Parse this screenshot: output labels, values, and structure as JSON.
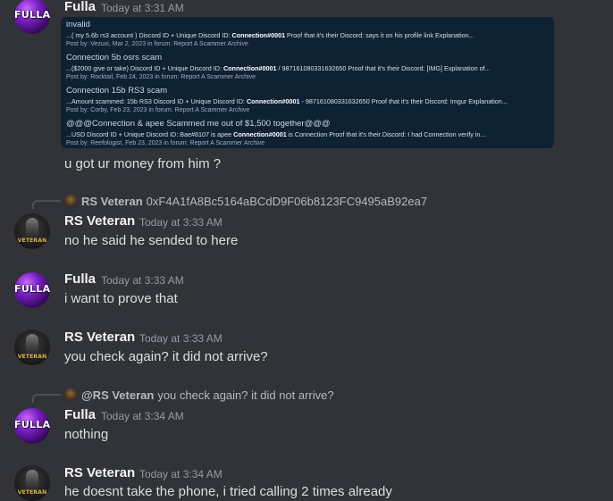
{
  "embed": {
    "results": [
      {
        "title": "invalid",
        "snippet_pre": "...( my 5.6b rs3 account ) Discord ID + Unique Discord ID: ",
        "snippet_bold": "Connection#0001",
        "snippet_post": " Proof that it's their Discord: says it on his profile link Explanation...",
        "posted": "Post by: Vezuxi, Mar 2, 2023 in forum: Report A Scammer Archive"
      },
      {
        "title": "Connection 5b osrs scam",
        "snippet_pre": "...($2000 give or take) Discord ID + Unique Discord ID: ",
        "snippet_bold": "Connection#0001",
        "snippet_post": " / 987161080331632650 Proof that it's their Discord: [IMG] Explanation of...",
        "posted": "Post by: Rocktail, Feb 24, 2023 in forum: Report A Scammer Archive"
      },
      {
        "title": "Connection 15b RS3 scam",
        "snippet_pre": "...Amount scammed: 15b RS3 Discord ID + Unique Discord ID: ",
        "snippet_bold": "Connection#0001",
        "snippet_post": " - 987161080331632650 Proof that it's their Discord: Imgur Explanation...",
        "posted": "Post by: Corby, Feb 23, 2023 in forum: Report A Scammer Archive"
      },
      {
        "title": "@@@Connection & apee Scammed me out of $1,500 together@@@",
        "snippet_pre": "...USD Discord ID + Unique Discord ID: Bae#8107 is apee ",
        "snippet_bold": "Connection#0001",
        "snippet_post": " is Connection Proof that it's their Discord: I had Connection verify in...",
        "posted": "Post by: Reefologist, Feb 23, 2023 in forum: Report A Scammer Archive"
      }
    ]
  },
  "messages": [
    {
      "author": "Fulla",
      "avatar_text": "FULLA",
      "timestamp": "Today at 3:31 AM",
      "text": "u got ur money from him ?"
    },
    {
      "author": "RS Veteran",
      "avatar_text": "VETERAN",
      "timestamp": "Today at 3:33 AM",
      "text": "no he said he sended to here",
      "reply": {
        "author": "RS Veteran",
        "text": "0xF4A1fA8Bc5164aBCdD9F06b8123FC9495aB92ea7"
      }
    },
    {
      "author": "Fulla",
      "avatar_text": "FULLA",
      "timestamp": "Today at 3:33 AM",
      "text": "i want to prove that"
    },
    {
      "author": "RS Veteran",
      "avatar_text": "VETERAN",
      "timestamp": "Today at 3:33 AM",
      "text": "you check again? it did not arrive?"
    },
    {
      "author": "Fulla",
      "avatar_text": "FULLA",
      "timestamp": "Today at 3:34 AM",
      "text": "nothing",
      "reply": {
        "author": "@RS Veteran",
        "text": "you check again? it did not arrive?"
      }
    },
    {
      "author": "RS Veteran",
      "avatar_text": "VETERAN",
      "timestamp": "Today at 3:34 AM",
      "text": "he doesnt take the phone, i tried calling 2 times already"
    }
  ]
}
